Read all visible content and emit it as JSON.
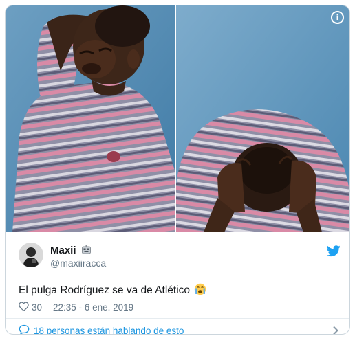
{
  "tweet": {
    "author_name": "Maxii",
    "author_handle": "@maxiiracca",
    "text": "El pulga Rodríguez se va de Atlético",
    "likes": "30",
    "timestamp": "22:35 - 6 ene. 2019"
  },
  "footer": {
    "conversation_label": "18 personas están hablando de esto"
  },
  "icons": {
    "info": "info-icon",
    "badge": "robot-face-icon",
    "brand": "twitter-bird-icon",
    "emoji": "crying-face-icon",
    "like": "heart-icon",
    "reply": "speech-bubble-icon",
    "chevron": "chevron-right-icon"
  },
  "colors": {
    "link_blue": "#1b95e0",
    "muted_gray": "#657786",
    "text_dark": "#14171a",
    "border": "#ccd6dd"
  }
}
